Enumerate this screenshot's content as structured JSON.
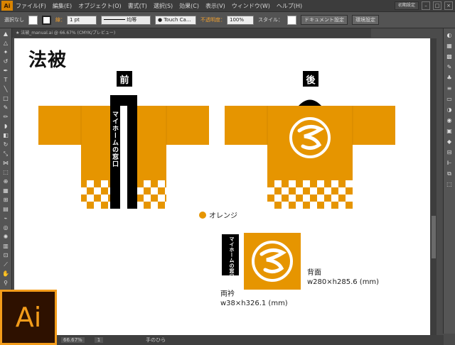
{
  "app": {
    "logo": "Ai",
    "workspace": "初期設定"
  },
  "menu": [
    "ファイル(F)",
    "編集(E)",
    "オブジェクト(O)",
    "書式(T)",
    "選択(S)",
    "効果(C)",
    "表示(V)",
    "ウィンドウ(W)",
    "ヘルプ(H)"
  ],
  "control": {
    "selection": "選択なし",
    "stroke_label": "線：",
    "stroke_value": "1 pt",
    "line_style": "均等",
    "brush": "Touch Ca...",
    "opacity_label": "不透明度：",
    "opacity_value": "100%",
    "style_label": "スタイル：",
    "doc_settings": "ドキュメント設定",
    "preferences": "環境設定"
  },
  "document_tab": "★ 法被_manual.ai @ 66.67% (CMYK/プレビュー)",
  "status": {
    "zoom": "66.67%",
    "page": "1",
    "tool": "手のひら"
  },
  "artboard": {
    "title": "法被",
    "front_label": "前",
    "back_label": "後",
    "collar_text": "マイホームの窓口",
    "legend": "オレンジ",
    "back_caption_1": "背面",
    "back_caption_2": "w280×h285.6 (mm)",
    "collar_caption_1": "両衿",
    "collar_caption_2": "w38×h326.1 (mm)"
  },
  "colors": {
    "orange": "#e69500",
    "black": "#000000",
    "white": "#ffffff"
  }
}
